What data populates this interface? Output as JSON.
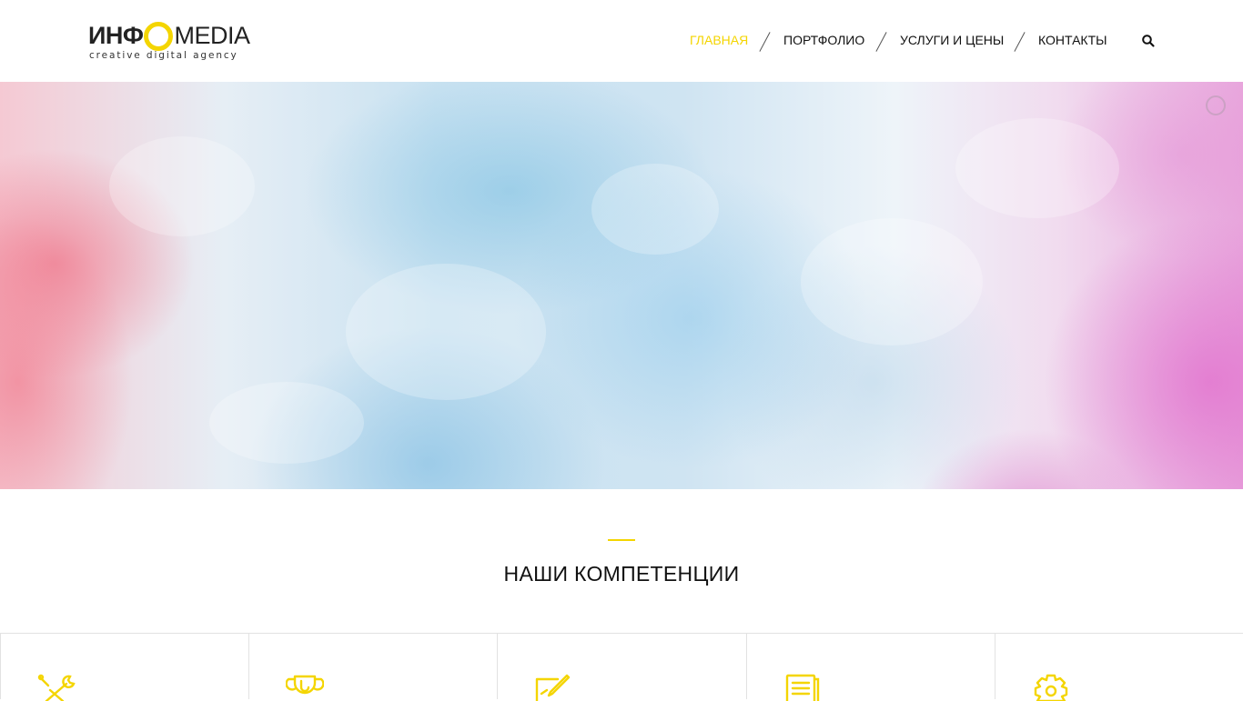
{
  "brand": {
    "logo_left": "ИНФ",
    "logo_right": "MEDIA",
    "tagline": "creative digital agency",
    "accent_color": "#f4d500"
  },
  "nav": {
    "items": [
      {
        "label": "ГЛАВНАЯ",
        "active": true
      },
      {
        "label": "ПОРТФОЛИО",
        "active": false
      },
      {
        "label": "УСЛУГИ И ЦЕНЫ",
        "active": false
      },
      {
        "label": "КОНТАКТЫ",
        "active": false
      }
    ],
    "search_icon": "search-icon"
  },
  "hero": {
    "background": "watercolor gradient pink-blue-magenta",
    "loader_icon": "loading-spinner-icon"
  },
  "section": {
    "title": "НАШИ КОМПЕТЕНЦИИ"
  },
  "competencies": [
    {
      "icon": "tools-icon"
    },
    {
      "icon": "trophy-icon"
    },
    {
      "icon": "edit-icon"
    },
    {
      "icon": "document-icon"
    },
    {
      "icon": "settings-gear-icon"
    }
  ]
}
